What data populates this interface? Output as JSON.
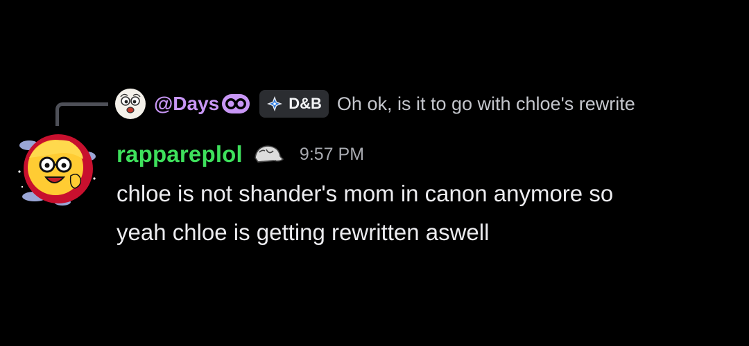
{
  "reply": {
    "username": "@Days",
    "server_tag": "D&B",
    "text": "Oh ok, is it to go with chloe's rewrite"
  },
  "message": {
    "author": "rappareplol",
    "timestamp": "9:57 PM",
    "lines": [
      "chloe is not shander's mom in canon anymore so",
      "yeah chloe is getting rewritten aswell"
    ]
  },
  "colors": {
    "background": "#000000",
    "reply_username": "#c896f5",
    "author_name": "#3ee05c",
    "message_text": "#ececef",
    "timestamp": "#a9abb1"
  },
  "icons": {
    "reply_avatar": "cartoon-face-icon",
    "name_decoration": "eyes-icon",
    "server_tag_icon": "diamond-sparkle-icon",
    "author_badge": "cap-badge-icon"
  }
}
